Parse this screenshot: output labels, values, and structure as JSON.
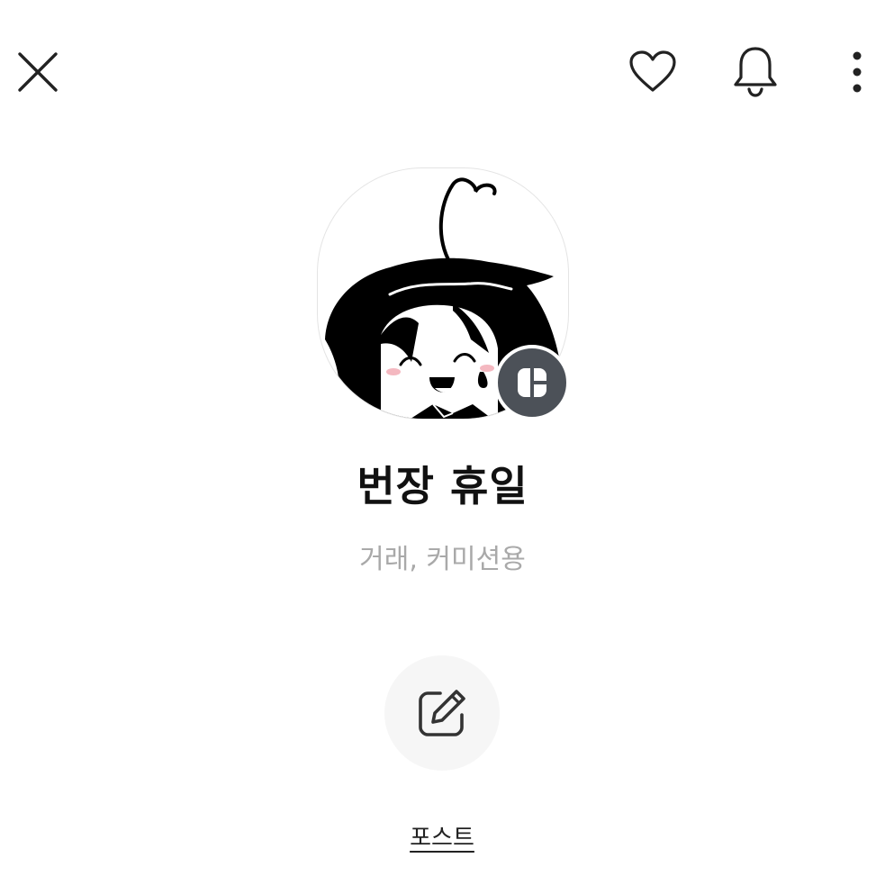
{
  "header": {
    "close_icon": "close-icon",
    "like_icon": "heart-icon",
    "notify_icon": "bell-icon",
    "more_icon": "more-vertical-icon"
  },
  "profile": {
    "avatar_description": "avatar",
    "badge_icon": "kakao-channel-icon",
    "name": "번장 휴일",
    "description": "거래, 커미션용"
  },
  "actions": {
    "post": {
      "icon": "edit-icon",
      "label": "포스트"
    }
  },
  "colors": {
    "badge_bg": "#4c5158",
    "description_text": "#a9a9a9",
    "action_circle_bg": "#f6f6f6"
  }
}
